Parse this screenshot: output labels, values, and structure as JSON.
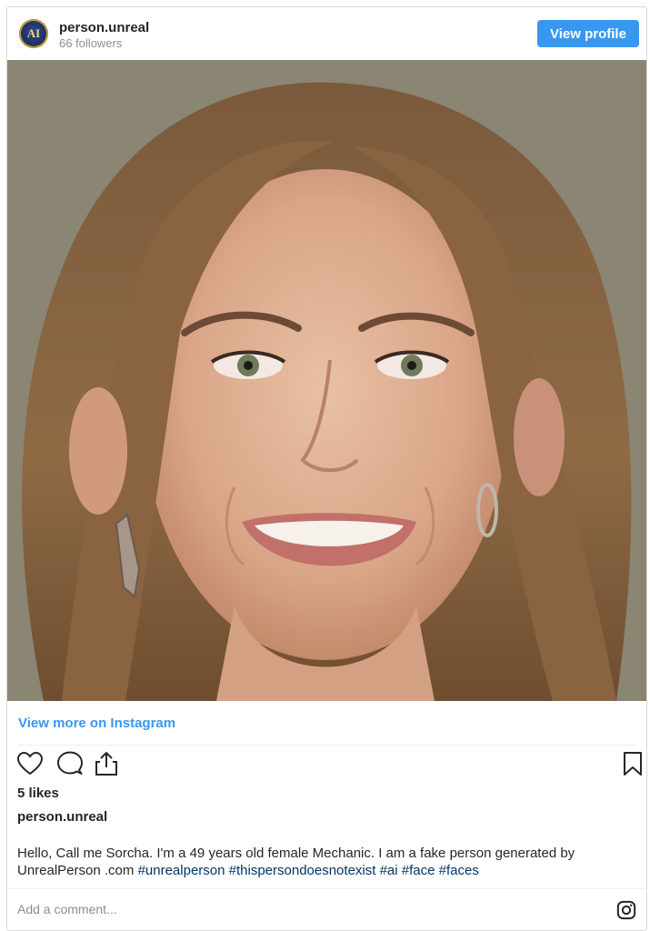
{
  "header": {
    "username": "person.unreal",
    "followers": "66 followers",
    "view_profile_label": "View profile",
    "avatar_text": "AI"
  },
  "view_more_label": "View more on Instagram",
  "likes": "5 likes",
  "caption": {
    "author": "person.unreal",
    "text": "Hello, Call me Sorcha. I'm a 49 years old female Mechanic. I am a fake person generated by UnrealPerson .com",
    "hashtags": [
      "#unrealperson",
      "#thispersondoesnotexist",
      "#ai",
      "#face",
      "#faces"
    ]
  },
  "comment_placeholder": "Add a comment...",
  "icons": [
    "heart-icon",
    "comment-icon",
    "share-icon",
    "bookmark-icon",
    "instagram-icon"
  ],
  "colors": {
    "accent": "#3897f0",
    "hashtag": "#003569",
    "muted": "#8e8e8e"
  }
}
